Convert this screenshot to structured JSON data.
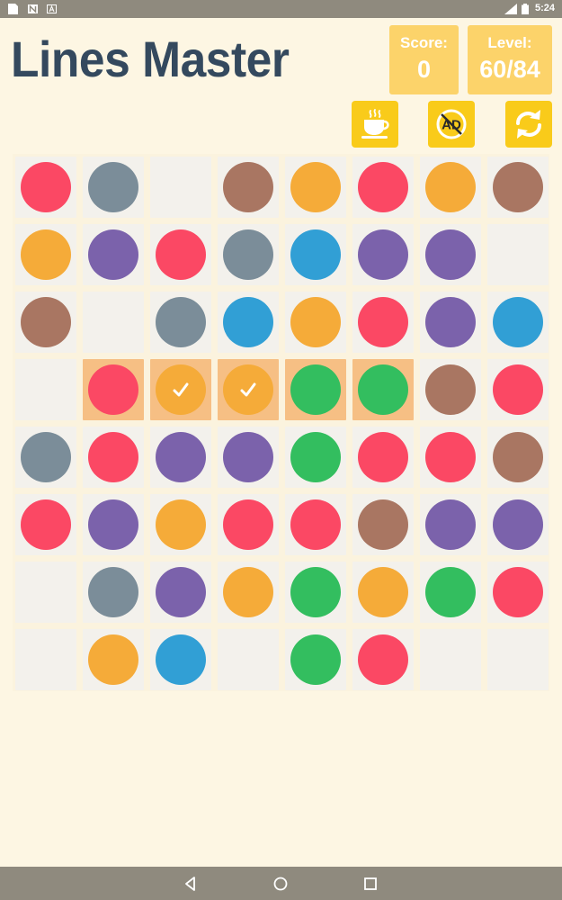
{
  "status_bar": {
    "time": "5:24",
    "icons": [
      "sim-card-icon",
      "n-notification-icon",
      "a-notification-icon",
      "lte-signal-icon",
      "battery-icon"
    ]
  },
  "header": {
    "title": "Lines Master",
    "score_label": "Score:",
    "score_value": "0",
    "level_label": "Level:",
    "level_value": "60/84"
  },
  "toolbar": {
    "buttons": [
      "coffee-cup-icon",
      "no-ads-icon",
      "restart-icon"
    ],
    "noad_text": "AD"
  },
  "colors": {
    "red": "#fb4864",
    "gray": "#7b8d99",
    "brown": "#a97662",
    "orange": "#f5ab39",
    "purple": "#7b62ab",
    "blue": "#319fd5",
    "green": "#33be5f",
    "accent": "#f9cb1a",
    "stat_box": "#fcd36a",
    "title": "#34495e",
    "selected_cell": "#f6bf84",
    "empty_cell": "#f3f1ec"
  },
  "board": {
    "rows": 8,
    "cols": 8,
    "cells": [
      [
        "red",
        "gray",
        null,
        "brown",
        "orange",
        "red",
        "orange",
        "brown"
      ],
      [
        "orange",
        "purple",
        "red",
        "gray",
        "blue",
        "purple",
        "purple",
        null
      ],
      [
        "brown",
        null,
        "gray",
        "blue",
        "orange",
        "red",
        "purple",
        "blue"
      ],
      [
        null,
        "red",
        "orange",
        "orange",
        "green",
        "green",
        "brown",
        "red"
      ],
      [
        "gray",
        "red",
        "purple",
        "purple",
        "green",
        "red",
        "red",
        "brown"
      ],
      [
        "red",
        "purple",
        "orange",
        "red",
        "red",
        "brown",
        "purple",
        "purple"
      ],
      [
        null,
        "gray",
        "purple",
        "orange",
        "green",
        "orange",
        "green",
        "red"
      ],
      [
        null,
        "orange",
        "blue",
        null,
        "green",
        "red",
        null,
        null
      ]
    ],
    "selected": [
      [
        3,
        1
      ],
      [
        3,
        2
      ],
      [
        3,
        3
      ],
      [
        3,
        4
      ],
      [
        3,
        5
      ]
    ],
    "checked": [
      [
        3,
        2
      ],
      [
        3,
        3
      ]
    ]
  },
  "nav_bar": {
    "buttons": [
      "back-icon",
      "home-icon",
      "recents-icon"
    ]
  }
}
